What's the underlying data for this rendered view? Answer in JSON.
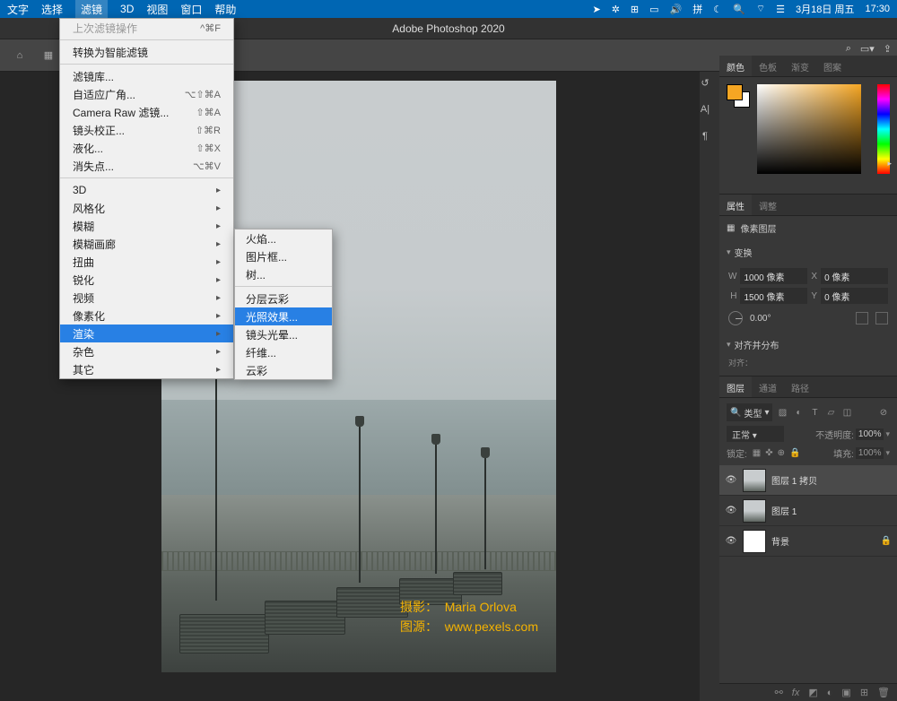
{
  "mac_menu": {
    "items": [
      "文字",
      "选择",
      "滤镜",
      "3D",
      "视图",
      "窗口",
      "帮助"
    ],
    "selected_index": 2,
    "status_date": "3月18日 周五",
    "status_time": "17:30",
    "input_method": "拼"
  },
  "app_title": "Adobe Photoshop 2020",
  "filter_menu": {
    "last_filter": {
      "label": "上次滤镜操作",
      "shortcut": "^⌘F",
      "disabled": true
    },
    "convert_smart": "转换为智能滤镜",
    "group1": [
      {
        "label": "滤镜库..."
      },
      {
        "label": "自适应广角...",
        "shortcut": "⌥⇧⌘A"
      },
      {
        "label": "Camera Raw 滤镜...",
        "shortcut": "⇧⌘A"
      },
      {
        "label": "镜头校正...",
        "shortcut": "⇧⌘R"
      },
      {
        "label": "液化...",
        "shortcut": "⇧⌘X"
      },
      {
        "label": "消失点...",
        "shortcut": "⌥⌘V"
      }
    ],
    "group2": [
      {
        "label": "3D",
        "sub": true
      },
      {
        "label": "风格化",
        "sub": true
      },
      {
        "label": "模糊",
        "sub": true
      },
      {
        "label": "模糊画廊",
        "sub": true
      },
      {
        "label": "扭曲",
        "sub": true
      },
      {
        "label": "锐化",
        "sub": true
      },
      {
        "label": "视频",
        "sub": true
      },
      {
        "label": "像素化",
        "sub": true
      },
      {
        "label": "渲染",
        "sub": true,
        "highlighted": true
      },
      {
        "label": "杂色",
        "sub": true
      },
      {
        "label": "其它",
        "sub": true
      }
    ]
  },
  "render_submenu": {
    "group1": [
      "火焰...",
      "图片框...",
      "树..."
    ],
    "group2": [
      {
        "label": "分层云彩"
      },
      {
        "label": "光照效果...",
        "highlighted": true
      },
      {
        "label": "镜头光晕..."
      },
      {
        "label": "纤维..."
      },
      {
        "label": "云彩"
      }
    ]
  },
  "credit": {
    "photo_label": "摄影：",
    "photographer": "Maria Orlova",
    "source_label": "图源：",
    "source": "www.pexels.com"
  },
  "right": {
    "color_tabs": [
      "颜色",
      "色板",
      "渐变",
      "图案"
    ],
    "color_active": 0,
    "props_tabs": [
      "属性",
      "调整"
    ],
    "props_active": 0,
    "pixel_layer": "像素图层",
    "transform": "变换",
    "W_label": "W",
    "W_val": "1000 像素",
    "X_label": "X",
    "X_val": "0 像素",
    "H_label": "H",
    "H_val": "1500 像素",
    "Y_label": "Y",
    "Y_val": "0 像素",
    "angle": "0.00°",
    "align": "对齐并分布",
    "align_note": "对齐：",
    "layers_tabs": [
      "图层",
      "通道",
      "路径"
    ],
    "layers_active": 0,
    "kind_label": "类型",
    "blend_mode": "正常",
    "opacity_label": "不透明度:",
    "opacity_val": "100%",
    "lock_label": "锁定:",
    "fill_label": "填充:",
    "fill_val": "100%",
    "layers": [
      {
        "name": "图层 1 拷贝",
        "active": true
      },
      {
        "name": "图层 1"
      },
      {
        "name": "背景",
        "locked": true,
        "white": true
      }
    ]
  },
  "search_icon": "⌕"
}
